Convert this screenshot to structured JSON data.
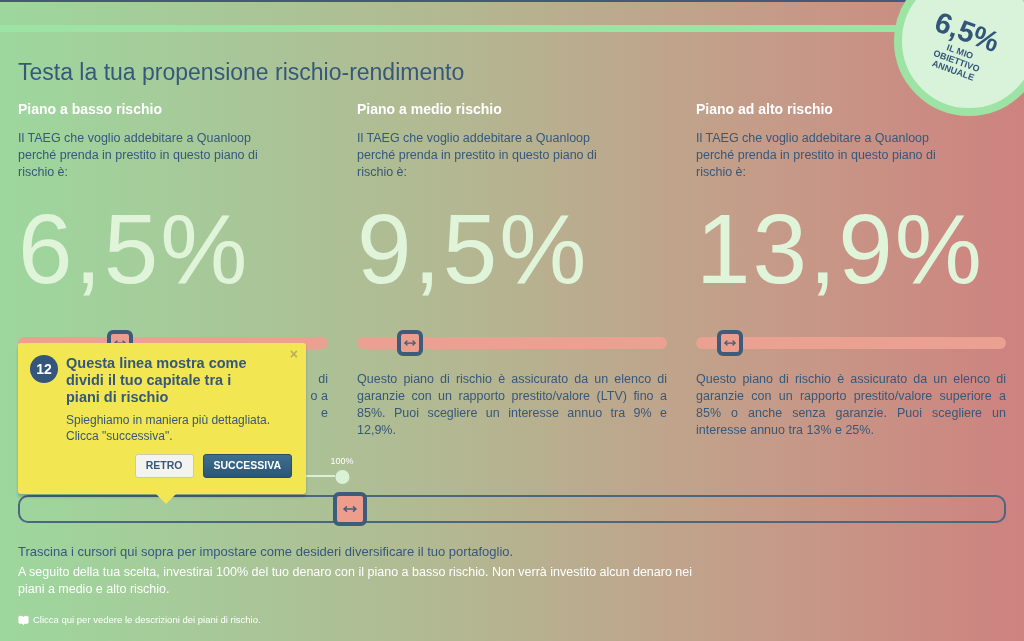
{
  "goal": {
    "value": "6,5%",
    "label_lines": [
      "IL MIO",
      "OBIETTIVO",
      "ANNUALE"
    ]
  },
  "title": "Testa la tua propensione rischio-rendimento",
  "plans": [
    {
      "name": "Piano a basso rischio",
      "prompt": "Il TAEG che voglio addebitare a Quanloop perché prenda in prestito in questo piano di rischio è:",
      "rate": "6,5%",
      "level": 0.33,
      "visible_fragments": [
        "di",
        "o a",
        "e"
      ]
    },
    {
      "name": "Piano a medio rischio",
      "prompt": "Il TAEG che voglio addebitare a Quanloop perché prenda in prestito in questo piano di rischio è:",
      "rate": "9,5%",
      "level": 0.17,
      "description": "Questo piano di rischio è assicurato da un elenco di garanzie con un rapporto prestito/valore (LTV) fino a 85%. Puoi scegliere un interesse annuo tra 9% e 12,9%."
    },
    {
      "name": "Piano ad alto rischio",
      "prompt": "Il TAEG che voglio addebitare a Quanloop perché prenda in prestito in questo piano di rischio è:",
      "rate": "13,9%",
      "level": 0.11,
      "description": "Questo piano di rischio è assicurato da un elenco di garanzie con un rapporto prestito/valore superiore a 85% o anche senza garanzie. Puoi scegliere un interesse annuo tra 13% e 25%."
    }
  ],
  "allocation": {
    "marker": "100%",
    "level": 0.335
  },
  "tour_popover": {
    "step": "12",
    "close": "×",
    "title": "Questa linea mostra come dividi il tuo capitale tra i piani di rischio",
    "body": [
      "Spieghiamo in maniera più dettagliata.",
      "Clicca \"successiva\"."
    ],
    "buttons": [
      {
        "label": "RETRO",
        "kind": "secondary"
      },
      {
        "label": "SUCCESSIVA",
        "kind": "primary"
      }
    ]
  },
  "instructions": "Trascina i cursori qui sopra per impostare come desideri diversificare il tuo portafoglio.",
  "result": "A seguito della tua scelta, investirai 100% del tuo denaro con il piano a basso rischio. Non verrà investito alcun denaro nei piani a medio e alto rischio.",
  "link": "Clicca qui per vedere le descrizioni dei piani di rischio."
}
